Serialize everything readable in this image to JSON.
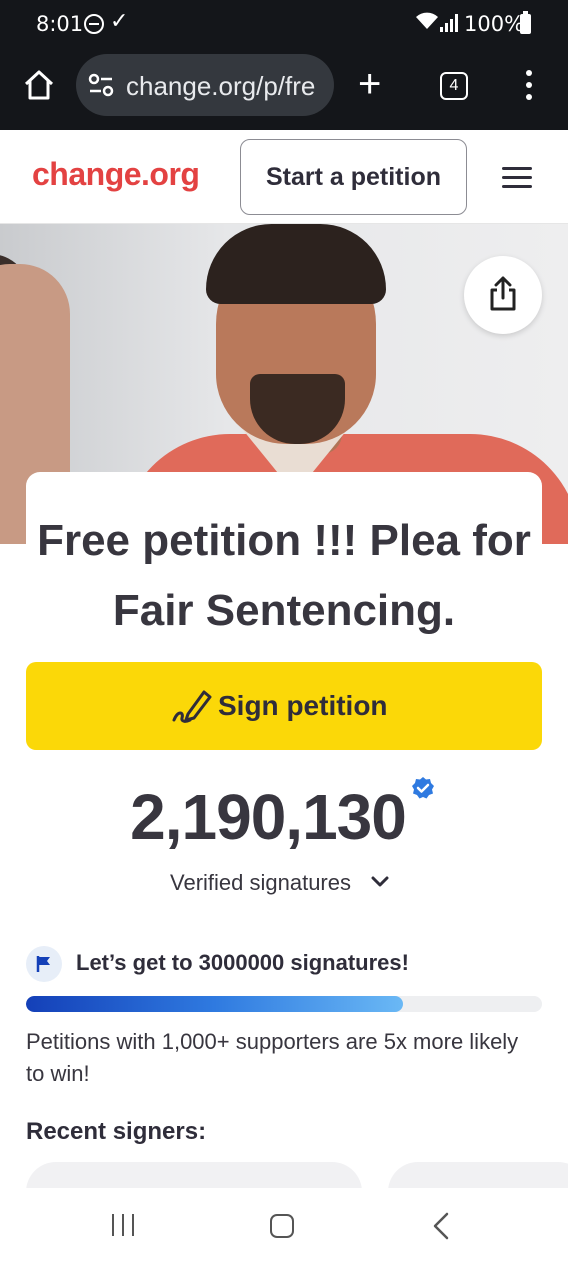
{
  "status_bar": {
    "time": "8:01",
    "battery": "100%"
  },
  "browser": {
    "url": "change.org/p/fre",
    "tab_count": "4"
  },
  "header": {
    "logo": "change.org",
    "start_petition": "Start a petition"
  },
  "petition": {
    "title": "Free petition !!! Plea for Fair Sentencing.",
    "sign_button": "Sign petition",
    "signature_count": "2,190,130",
    "verified_label": "Verified signatures",
    "goal_text": "Let’s get to 3000000 signatures!",
    "progress_fraction": 0.73,
    "supporters_note": "Petitions with 1,000+ supporters are 5x more likely to win!",
    "recent_signers_heading": "Recent signers:"
  },
  "colors": {
    "brand_red": "#e34242",
    "sign_yellow": "#fbd808",
    "verified_blue": "#2f7ae0"
  },
  "icons": [
    "home-icon",
    "tune-icon",
    "plus-icon",
    "tabs-icon",
    "more-vert-icon",
    "hamburger-icon",
    "share-icon",
    "pen-icon",
    "verified-icon",
    "chevron-down-icon",
    "flag-icon",
    "nav-recents-icon",
    "nav-home-icon",
    "nav-back-icon"
  ]
}
